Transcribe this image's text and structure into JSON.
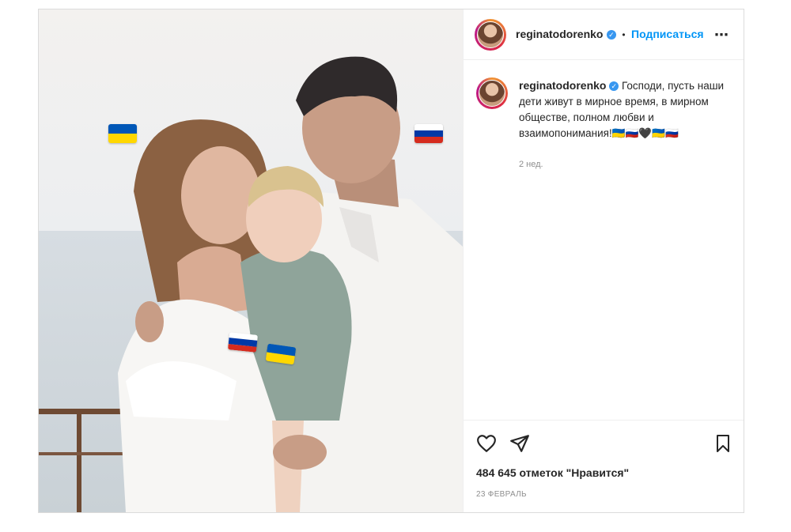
{
  "post": {
    "author": {
      "username": "reginatodorenko",
      "verified_icon": "verified-badge-icon",
      "separator": "•",
      "follow_label": "Подписаться"
    },
    "caption": {
      "username": "reginatodorenko",
      "text": "Господи, пусть наши дети живут в мирное время, в мирном обществе, полном любви и взаимопонимания!🇺🇦🇷🇺🖤🇺🇦🇷🇺",
      "time_ago": "2 нед."
    },
    "likes": "484 645 отметок \"Нравится\"",
    "date": "23 ФЕВРАЛЬ",
    "icons": {
      "more": "more-options-icon",
      "like": "heart-icon",
      "share": "share-icon",
      "save": "bookmark-icon"
    },
    "flags": {
      "ukraine": [
        "#0057b7",
        "#ffd700"
      ],
      "russia": [
        "#ffffff",
        "#0039a6",
        "#d52b1e"
      ]
    }
  }
}
